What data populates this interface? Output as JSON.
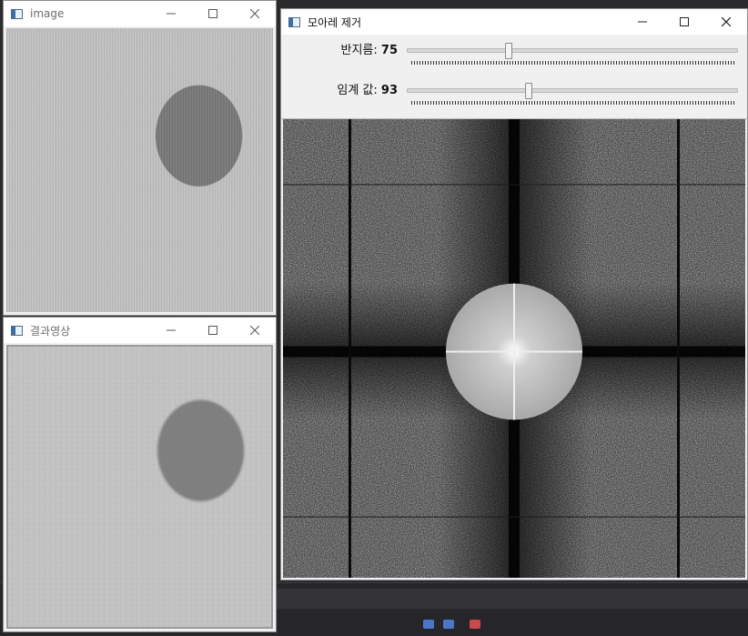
{
  "windows": {
    "image": {
      "title": "image"
    },
    "result": {
      "title": "결과영상"
    },
    "moire": {
      "title": "모아레 제거",
      "trackbars": [
        {
          "label": "반지름",
          "value": "75",
          "fraction": 0.305
        },
        {
          "label": "임계 값",
          "value": "93",
          "fraction": 0.365
        }
      ]
    }
  },
  "icons": {
    "minimize": "minimize-icon",
    "maximize": "maximize-icon",
    "close": "close-icon"
  },
  "colors": {
    "titlebar": "#ffffff",
    "panel": "#f0f0f0",
    "spectrum_background": "#2a2a2a",
    "spectrum_disc": "#b8b8b8"
  }
}
